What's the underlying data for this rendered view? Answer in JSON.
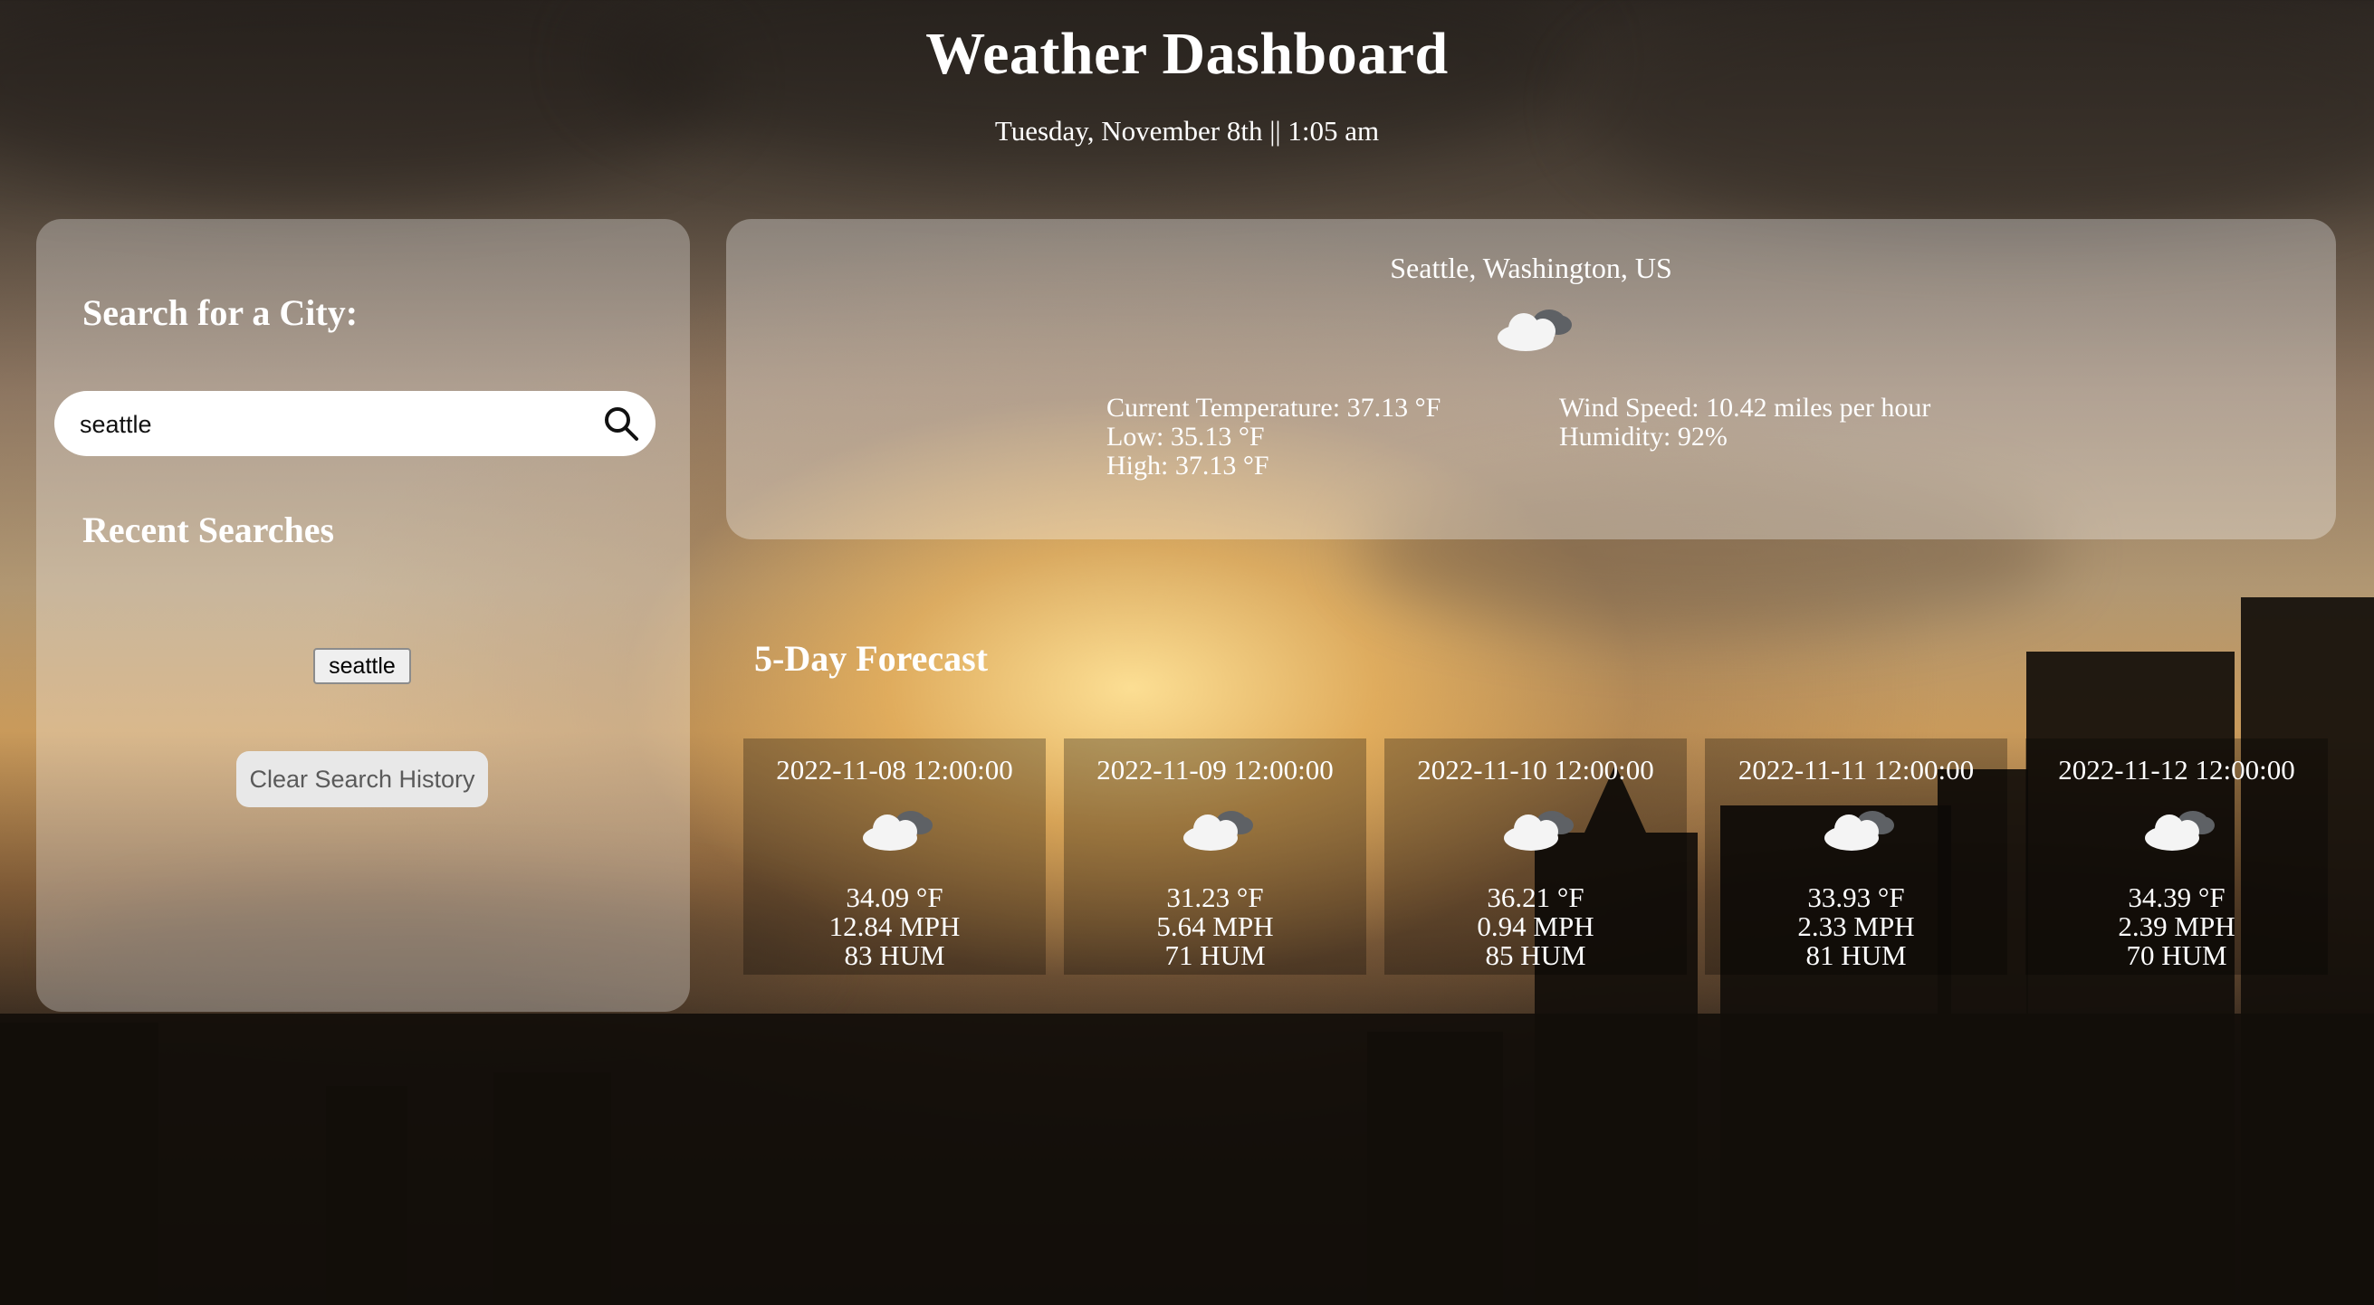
{
  "header": {
    "title": "Weather Dashboard",
    "datetime": "Tuesday, November 8th || 1:05 am"
  },
  "sidebar": {
    "search_heading": "Search for a City:",
    "search_input": {
      "value": "seattle",
      "placeholder": ""
    },
    "search_icon": "search-icon",
    "recent_heading": "Recent Searches",
    "recent_searches": [
      "seattle"
    ],
    "clear_button": "Clear Search History"
  },
  "current": {
    "city": "Seattle, Washington, US",
    "icon": "cloud-icon",
    "current_temperature": "Current Temperature: 37.13 °F",
    "low": "Low: 35.13 °F",
    "high": "High: 37.13 °F",
    "wind_speed": "Wind Speed: 10.42 miles per hour",
    "humidity": "Humidity: 92%"
  },
  "forecast": {
    "heading": "5-Day Forecast",
    "days": [
      {
        "date": "2022-11-08 12:00:00",
        "icon": "cloud-icon",
        "temp": "34.09 °F",
        "wind": "12.84 MPH",
        "humidity": "83 HUM"
      },
      {
        "date": "2022-11-09 12:00:00",
        "icon": "cloud-icon",
        "temp": "31.23 °F",
        "wind": "5.64 MPH",
        "humidity": "71 HUM"
      },
      {
        "date": "2022-11-10 12:00:00",
        "icon": "cloud-icon",
        "temp": "36.21 °F",
        "wind": "0.94 MPH",
        "humidity": "85 HUM"
      },
      {
        "date": "2022-11-11 12:00:00",
        "icon": "cloud-icon",
        "temp": "33.93 °F",
        "wind": "2.33 MPH",
        "humidity": "81 HUM"
      },
      {
        "date": "2022-11-12 12:00:00",
        "icon": "cloud-icon",
        "temp": "34.39 °F",
        "wind": "2.39 MPH",
        "humidity": "70 HUM"
      }
    ]
  },
  "colors": {
    "text": "#ffffff",
    "panel": "rgba(255,255,255,0.30)",
    "forecast_card": "rgba(0,0,0,0.28)"
  }
}
